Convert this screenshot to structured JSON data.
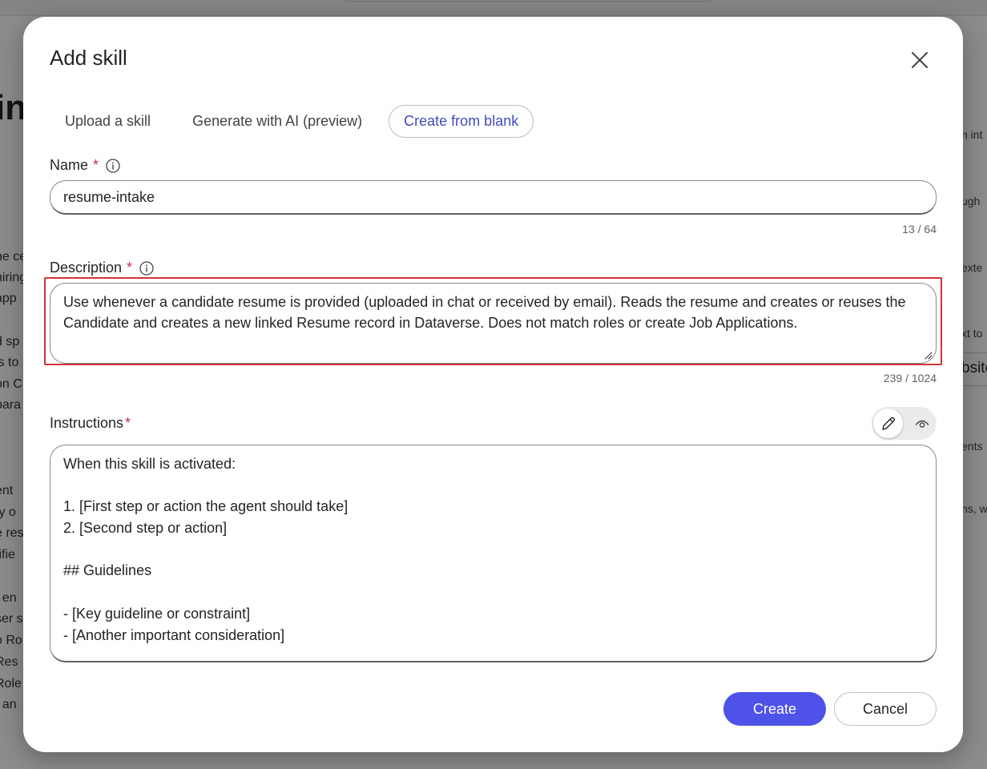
{
  "background": {
    "heading_fragment": "in",
    "left_fragments": [
      "he ce",
      "hiring",
      "app",
      "d sp",
      "ls to",
      "on C",
      "para",
      "ent",
      "ty o",
      "e res",
      "tifie",
      "t en",
      "ser s",
      "o Ro",
      "Res",
      "Role",
      ", an"
    ],
    "right_fragments": [
      "n int",
      "ugh",
      "exte",
      "xt to",
      "ents",
      "ns, w"
    ],
    "right_bold_fragment": "bsite"
  },
  "dialog": {
    "title": "Add skill",
    "close_label": "Close",
    "tabs": [
      {
        "label": "Upload a skill",
        "selected": false
      },
      {
        "label": "Generate with AI (preview)",
        "selected": false
      },
      {
        "label": "Create from blank",
        "selected": true
      }
    ],
    "name": {
      "label": "Name",
      "required_mark": "*",
      "value": "resume-intake",
      "counter": "13 / 64"
    },
    "description": {
      "label": "Description",
      "required_mark": "*",
      "value": "Use whenever a candidate resume is provided (uploaded in chat or received by email). Reads the resume and creates or reuses the Candidate and creates a new linked Resume record in Dataverse. Does not match roles or create Job Applications.",
      "counter": "239 / 1024"
    },
    "instructions": {
      "label": "Instructions",
      "required_mark": "*",
      "lines": [
        "When this skill is activated:",
        "",
        "1. [First step or action the agent should take]",
        "2. [Second step or action]",
        "",
        "## Guidelines",
        "",
        "- [Key guideline or constraint]",
        "- [Another important consideration]"
      ]
    },
    "actions": {
      "create_label": "Create",
      "cancel_label": "Cancel"
    },
    "colors": {
      "primary": "#4f52e8",
      "selected_tab_text": "#3f4cb7",
      "required": "#c4314b",
      "highlight": "#d13438"
    }
  }
}
